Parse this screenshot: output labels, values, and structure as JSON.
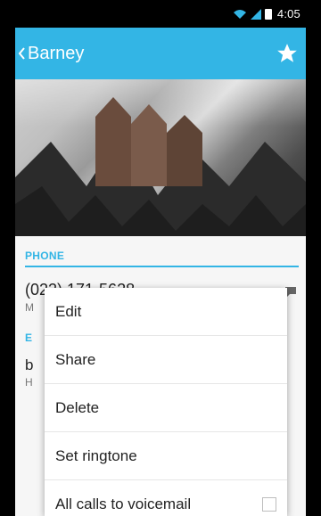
{
  "status": {
    "time": "4:05"
  },
  "appbar": {
    "title": "Barney",
    "favorite_icon": "star-icon"
  },
  "contact": {
    "phone": {
      "section_label": "PHONE",
      "number": "(022) 171-5628",
      "label_initial": "M"
    },
    "email": {
      "section_label_initial": "E",
      "address_initial": "b",
      "label_initial": "H"
    }
  },
  "menu": {
    "items": [
      {
        "label": "Edit"
      },
      {
        "label": "Share"
      },
      {
        "label": "Delete"
      },
      {
        "label": "Set ringtone"
      },
      {
        "label": "All calls to voicemail",
        "checked": false
      }
    ]
  },
  "colors": {
    "accent": "#33b5e5",
    "statusbar": "#000000",
    "menu_bg": "#ffffff"
  }
}
